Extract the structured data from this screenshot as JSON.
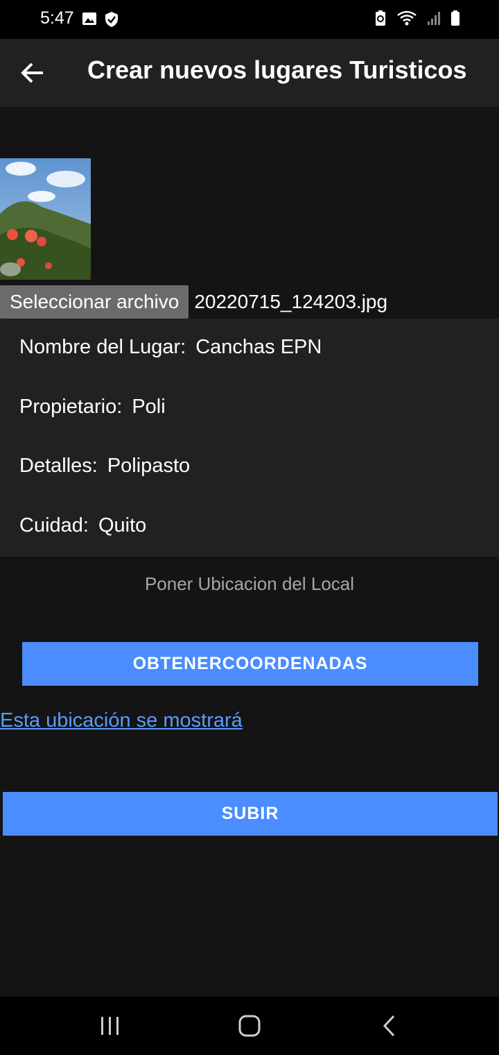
{
  "status_bar": {
    "time": "5:47",
    "left_icons": [
      "image-icon",
      "shield-check-icon"
    ],
    "right_icons": [
      "battery-saver-icon",
      "wifi-icon",
      "signal-icon",
      "battery-icon"
    ]
  },
  "app_bar": {
    "back_icon": "arrow-left-icon",
    "title": "Crear nuevos lugares Turisticos"
  },
  "file_picker": {
    "button_label": "Seleccionar archivo",
    "file_name": "20220715_124203.jpg"
  },
  "form": {
    "fields": [
      {
        "label": "Nombre del Lugar:",
        "value": "Canchas EPN"
      },
      {
        "label": "Propietario:",
        "value": "Poli"
      },
      {
        "label": "Detalles:",
        "value": "Polipasto"
      },
      {
        "label": "Cuidad:",
        "value": "Quito"
      }
    ]
  },
  "location": {
    "hint": "Poner Ubicacion del Local",
    "coords_button": "OBTENERCOORDENADAS",
    "link_text": "Esta ubicación se mostrará"
  },
  "submit_button": "SUBIR",
  "nav_bar": {
    "icons": [
      "recent-apps-icon",
      "home-icon",
      "back-icon"
    ]
  },
  "colors": {
    "background": "#141414",
    "surface": "#212121",
    "accent": "#4b8cff",
    "link": "#5a9bff"
  }
}
